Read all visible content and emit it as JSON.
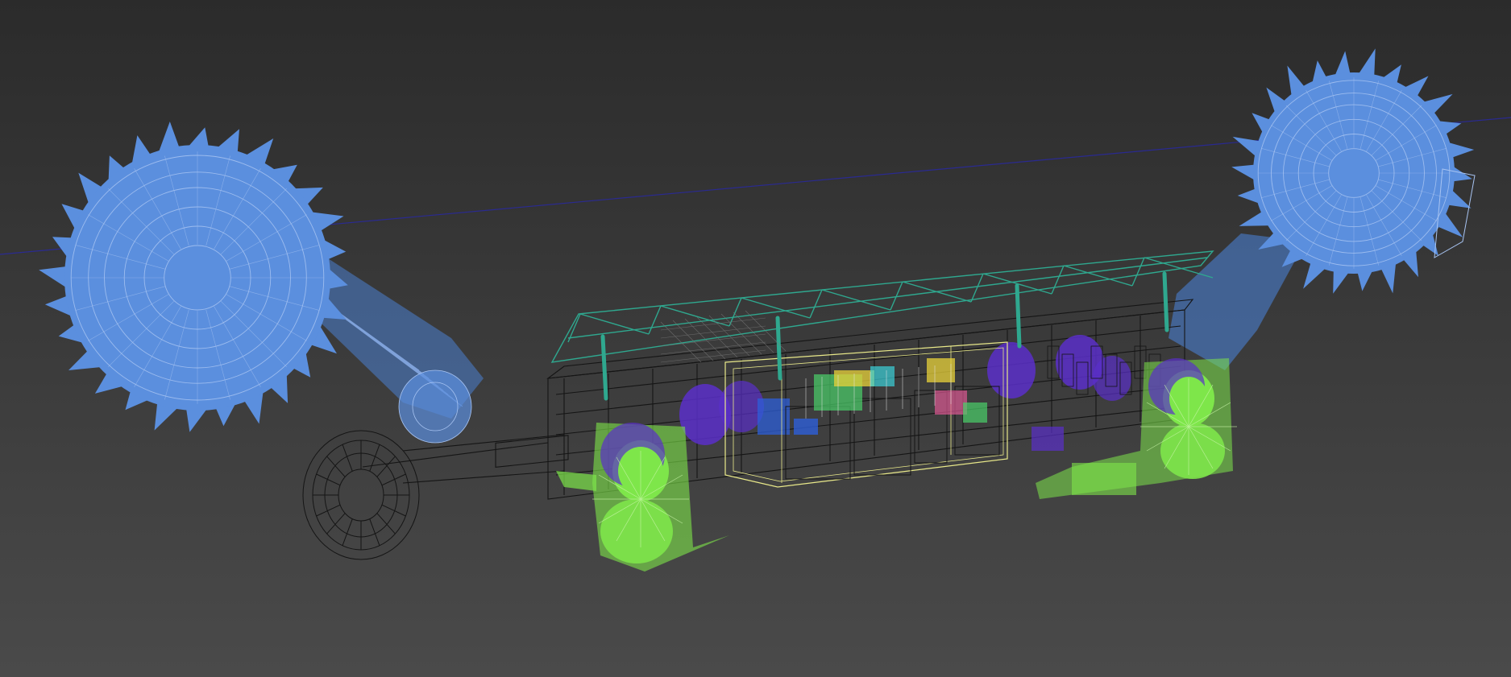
{
  "viewport": {
    "background_top": "#2b2b2b",
    "background_bottom": "#4a4a4a"
  },
  "colors": {
    "bucket_wheel": "#5b8fde",
    "bucket_wheel_dark": "#4a7fd0",
    "crawler": "#7ee64a",
    "truss": "#2fa88f",
    "chassis": "#151515",
    "cabin_highlight": "#e9e98a",
    "machinery_purple": "#5a2fc9",
    "machinery_blue": "#2e5fd8",
    "grid_axis": "#2828a8",
    "detail_green": "#4ad06a",
    "detail_yellow": "#e8d23a",
    "detail_pink": "#e85a9a",
    "detail_cyan": "#3ad0d8"
  },
  "objects": [
    {
      "name": "left-bucket-wheel",
      "icon": "gear-wheel"
    },
    {
      "name": "right-bucket-wheel",
      "icon": "gear-wheel"
    },
    {
      "name": "left-boom-arm",
      "icon": "boom"
    },
    {
      "name": "support-truss",
      "icon": "truss"
    },
    {
      "name": "main-chassis",
      "icon": "box"
    },
    {
      "name": "control-cabin",
      "icon": "box"
    },
    {
      "name": "front-crawler",
      "icon": "crawler"
    },
    {
      "name": "rear-crawler",
      "icon": "crawler"
    },
    {
      "name": "rear-wheel",
      "icon": "wheel"
    }
  ]
}
